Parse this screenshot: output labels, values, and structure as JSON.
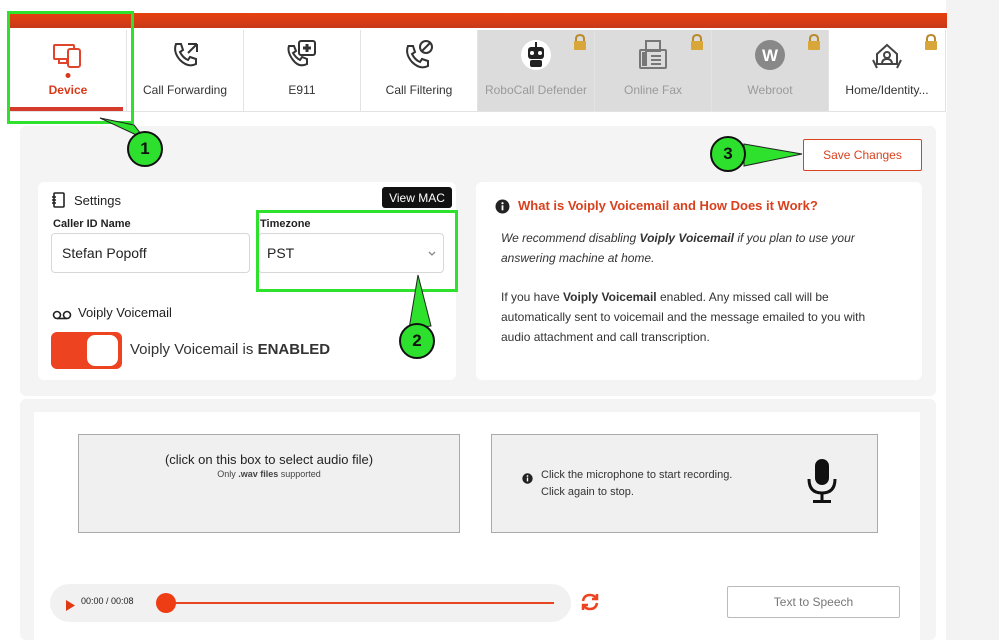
{
  "tabs": [
    {
      "label": "Device",
      "icon": "devices-icon",
      "locked": false,
      "active": true
    },
    {
      "label": "Call Forwarding",
      "icon": "call-forward-icon",
      "locked": false
    },
    {
      "label": "E911",
      "icon": "emergency-icon",
      "locked": false
    },
    {
      "label": "Call Filtering",
      "icon": "call-block-icon",
      "locked": false
    },
    {
      "label": "RoboCall Defender",
      "icon": "robot-icon",
      "locked": true
    },
    {
      "label": "Online Fax",
      "icon": "fax-icon",
      "locked": true
    },
    {
      "label": "Webroot",
      "icon": "webroot-icon",
      "locked": true
    },
    {
      "label": "Home/Identity...",
      "icon": "home-protect-icon",
      "locked": true
    }
  ],
  "annotations": [
    "1",
    "2",
    "3"
  ],
  "toolbar": {
    "save_label": "Save Changes"
  },
  "settings": {
    "title": "Settings",
    "view_mac_label": "View MAC",
    "caller_id_label": "Caller ID Name",
    "caller_id_value": "Stefan Popoff",
    "timezone_label": "Timezone",
    "timezone_value": "PST",
    "voicemail_title": "Voiply Voicemail",
    "voicemail_status_prefix": "Voiply Voicemail is ",
    "voicemail_status_value": "ENABLED",
    "voicemail_enabled": true
  },
  "info": {
    "title": "What is Voiply Voicemail and How Does it Work?",
    "p1_a": "We recommend disabling ",
    "p1_b": "Voiply Voicemail",
    "p1_c": " if you plan to use your",
    "p1_d": "answering machine at home.",
    "p2_a": "If you have ",
    "p2_b": "Voiply Voicemail",
    "p2_c": " enabled. Any missed call will be",
    "p2_d": "automatically sent to voicemail and the message emailed to you with",
    "p2_e": "audio attachment and call transcription."
  },
  "upload": {
    "main": "(click on this box to select audio file)",
    "sub_a": "Only ",
    "sub_b": ".wav files",
    "sub_c": " supported"
  },
  "recorder": {
    "line1": "Click the microphone to start recording.",
    "line2": "Click again to stop."
  },
  "player": {
    "time": "00:00 / 00:08",
    "progress": 0
  },
  "tts_label": "Text to Speech",
  "colors": {
    "accent": "#e8400f",
    "annotation": "#2ee02e"
  }
}
